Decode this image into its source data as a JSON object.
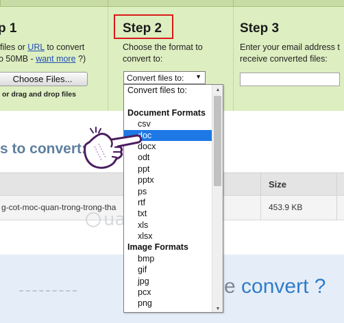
{
  "step1": {
    "title": "p 1",
    "line1_pre": " files or ",
    "line1_link": "URL",
    "line1_post": " to convert",
    "line2_pre": "o 50MB - ",
    "line2_link": "want more",
    "line2_post": " ?)",
    "choose_button": "Choose Files...",
    "drag_text": "or drag and drop files"
  },
  "step2": {
    "title": "Step 2",
    "line1": "Choose the format to",
    "line2": "convert to:",
    "select_value": "Convert files to:",
    "arrow": "▼"
  },
  "step3": {
    "title": "Step 3",
    "line1": "Enter your email address t",
    "line2": "receive converted files:",
    "email_value": ""
  },
  "files_heading": "s to convert:",
  "table": {
    "col_size": "Size",
    "rows": [
      {
        "name": "g-cot-moc-quan-trong-trong-tha",
        "size": "453.9 KB"
      }
    ]
  },
  "dropdown": {
    "placeholder": "Convert files to:",
    "document_group": "Document Formats",
    "document_formats": [
      "csv",
      "doc",
      "docx",
      "odt",
      "ppt",
      "pptx",
      "ps",
      "rtf",
      "txt",
      "xls",
      "xlsx"
    ],
    "image_group": "Image Formats",
    "image_formats": [
      "bmp",
      "gif",
      "jpg",
      "pcx",
      "png"
    ],
    "selected": "doc",
    "scroll_up": "▲",
    "scroll_down": "▼"
  },
  "bottom": {
    "dim_text": "e ",
    "convert_text": "convert ?"
  },
  "watermark": "uantrimang",
  "colors": {
    "step_bg": "#ddeec0",
    "highlight_box": "#d81919",
    "selection": "#1e78e6",
    "heading": "#5e7f9f",
    "convert_blue": "#2f7cc9"
  },
  "icons": [
    "hand-pointer-icon",
    "watermark-logo-icon",
    "dropdown-arrow-icon"
  ]
}
